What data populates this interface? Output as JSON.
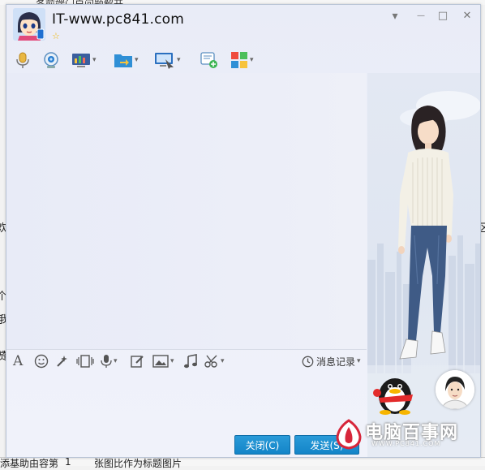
{
  "background": {
    "top_text": "各前端门户问题解开",
    "left_fragments": [
      "欢",
      "个",
      "我",
      "赞"
    ],
    "right_fragment": "区",
    "bottom_left": "添基助由容第",
    "bottom_num": "1",
    "bottom_right": "张图比作为标题图片"
  },
  "window": {
    "title": "IT-www.pc841.com",
    "controls": {
      "dropdown": "▾",
      "minimize": "—",
      "maximize": "□",
      "close": "✕"
    }
  },
  "toolbar": {
    "icons": [
      "microphone-icon",
      "video-camera-icon",
      "share-screen-icon",
      "send-file-icon",
      "remote-desktop-icon",
      "add-app-icon",
      "apps-grid-icon"
    ]
  },
  "format_bar": {
    "history_label": "消息记录"
  },
  "buttons": {
    "close_label": "关闭(C)",
    "send_label": "发送(S)"
  },
  "watermark": {
    "brand": "电脑百事网",
    "url": "WWW.PC841.COM"
  },
  "colors": {
    "accent": "#1a8bd0",
    "window_bg": "#eceef8",
    "watermark": "#d7263a"
  }
}
